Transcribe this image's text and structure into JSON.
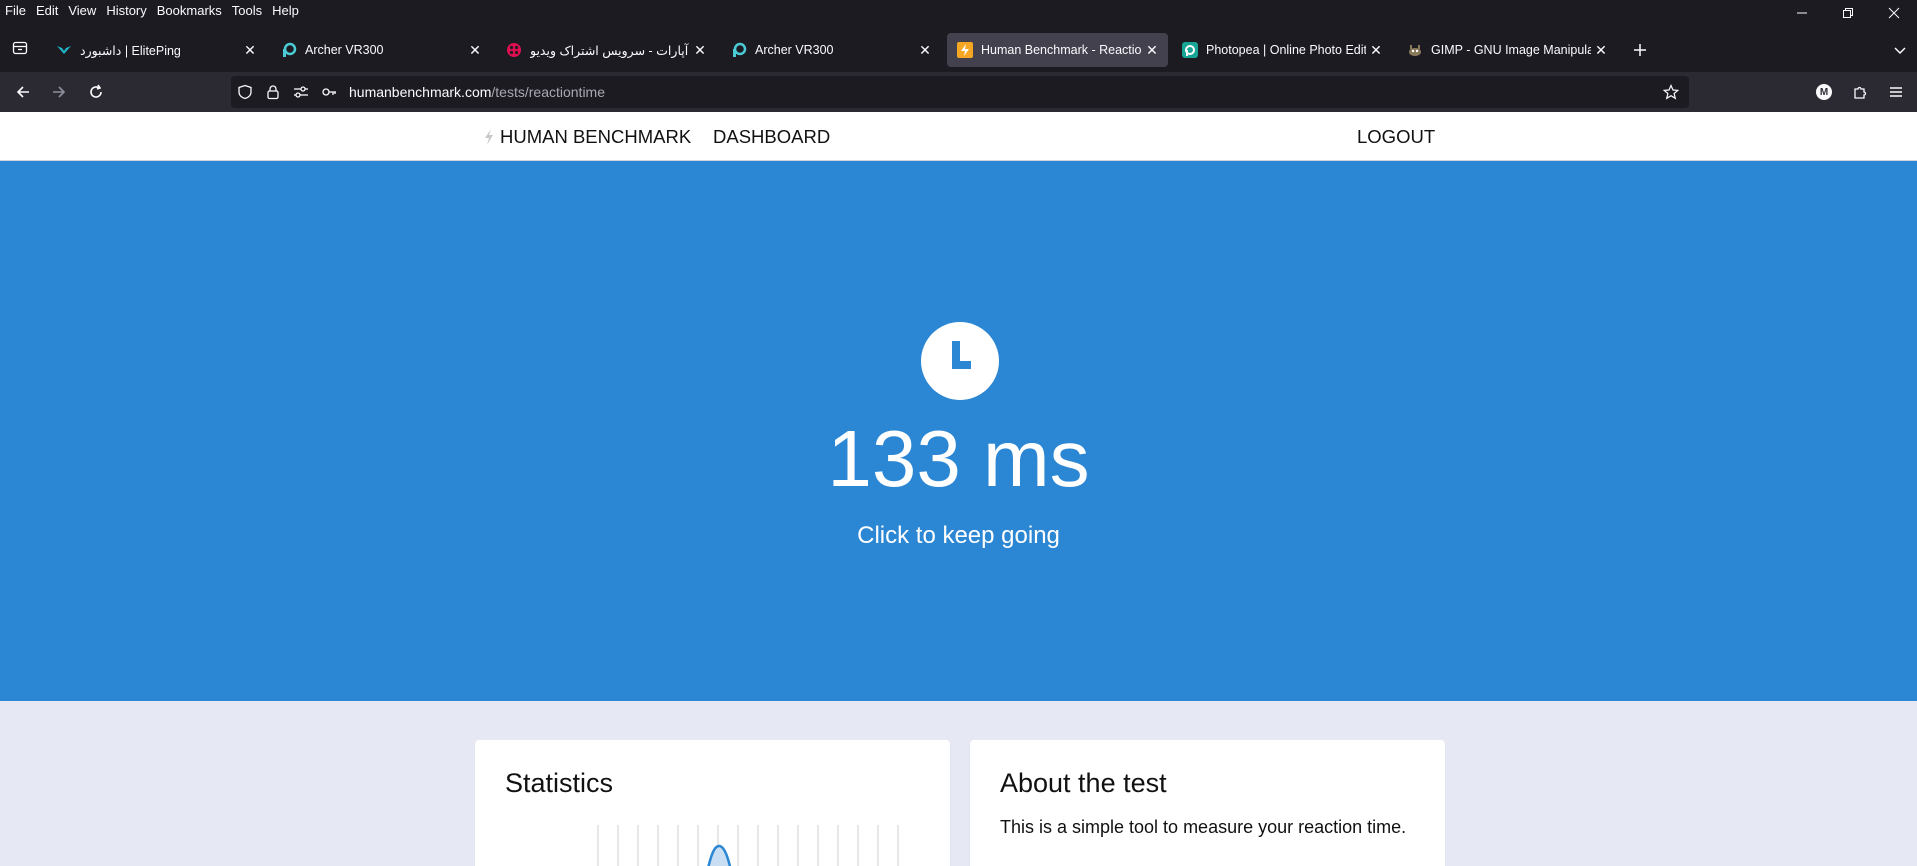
{
  "menubar": {
    "items": [
      "File",
      "Edit",
      "View",
      "History",
      "Bookmarks",
      "Tools",
      "Help"
    ]
  },
  "tabs": [
    {
      "title": "داشبورد | ElitePing",
      "icon": "eliteping-icon",
      "active": false
    },
    {
      "title": "Archer VR300",
      "icon": "tplink-icon",
      "active": false
    },
    {
      "title": "آپارات - سرویس اشتراک ویدیو",
      "icon": "aparat-icon",
      "active": false
    },
    {
      "title": "Archer VR300",
      "icon": "tplink-icon",
      "active": false
    },
    {
      "title": "Human Benchmark - Reaction Time",
      "icon": "bolt-icon",
      "active": true
    },
    {
      "title": "Photopea | Online Photo Editor",
      "icon": "photopea-icon",
      "active": false
    },
    {
      "title": "GIMP - GNU Image Manipulation Program",
      "icon": "gimp-icon",
      "active": false
    }
  ],
  "urlbar": {
    "host": "humanbenchmark.com",
    "path": "/tests/reactiontime"
  },
  "site_nav": {
    "brand": "HUMAN BENCHMARK",
    "dashboard": "DASHBOARD",
    "logout": "LOGOUT"
  },
  "hero": {
    "result": "133 ms",
    "subtitle": "Click to keep going",
    "background": "#2b87d3"
  },
  "cards": {
    "statistics_title": "Statistics",
    "about_title": "About the test",
    "about_text": "This is a simple tool to measure your reaction time."
  },
  "profile_initial": "M"
}
